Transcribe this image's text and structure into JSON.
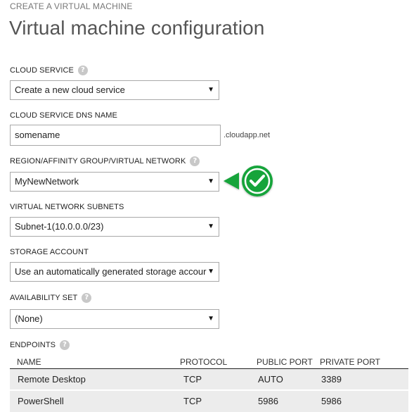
{
  "header": {
    "eyebrow": "CREATE A VIRTUAL MACHINE",
    "title": "Virtual machine configuration"
  },
  "cloud_service": {
    "label": "CLOUD SERVICE",
    "value": "Create a new cloud service"
  },
  "dns_name": {
    "label": "CLOUD SERVICE DNS NAME",
    "value": "somename",
    "suffix": ".cloudapp.net"
  },
  "region": {
    "label": "REGION/AFFINITY GROUP/VIRTUAL NETWORK",
    "value": "MyNewNetwork",
    "status_icon": "checkmark-icon",
    "status_color": "#1aa33a"
  },
  "subnets": {
    "label": "VIRTUAL NETWORK SUBNETS",
    "value": "Subnet-1(10.0.0.0/23)"
  },
  "storage": {
    "label": "STORAGE ACCOUNT",
    "value": "Use an automatically generated storage accour"
  },
  "availability": {
    "label": "AVAILABILITY SET",
    "value": "(None)"
  },
  "endpoints": {
    "label": "ENDPOINTS",
    "columns": [
      "NAME",
      "PROTOCOL",
      "PUBLIC PORT",
      "PRIVATE PORT"
    ],
    "rows": [
      [
        "Remote Desktop",
        "TCP",
        "AUTO",
        "3389"
      ],
      [
        "PowerShell",
        "TCP",
        "5986",
        "5986"
      ]
    ]
  },
  "icons": {
    "help": "?",
    "dropdown": "▼"
  }
}
